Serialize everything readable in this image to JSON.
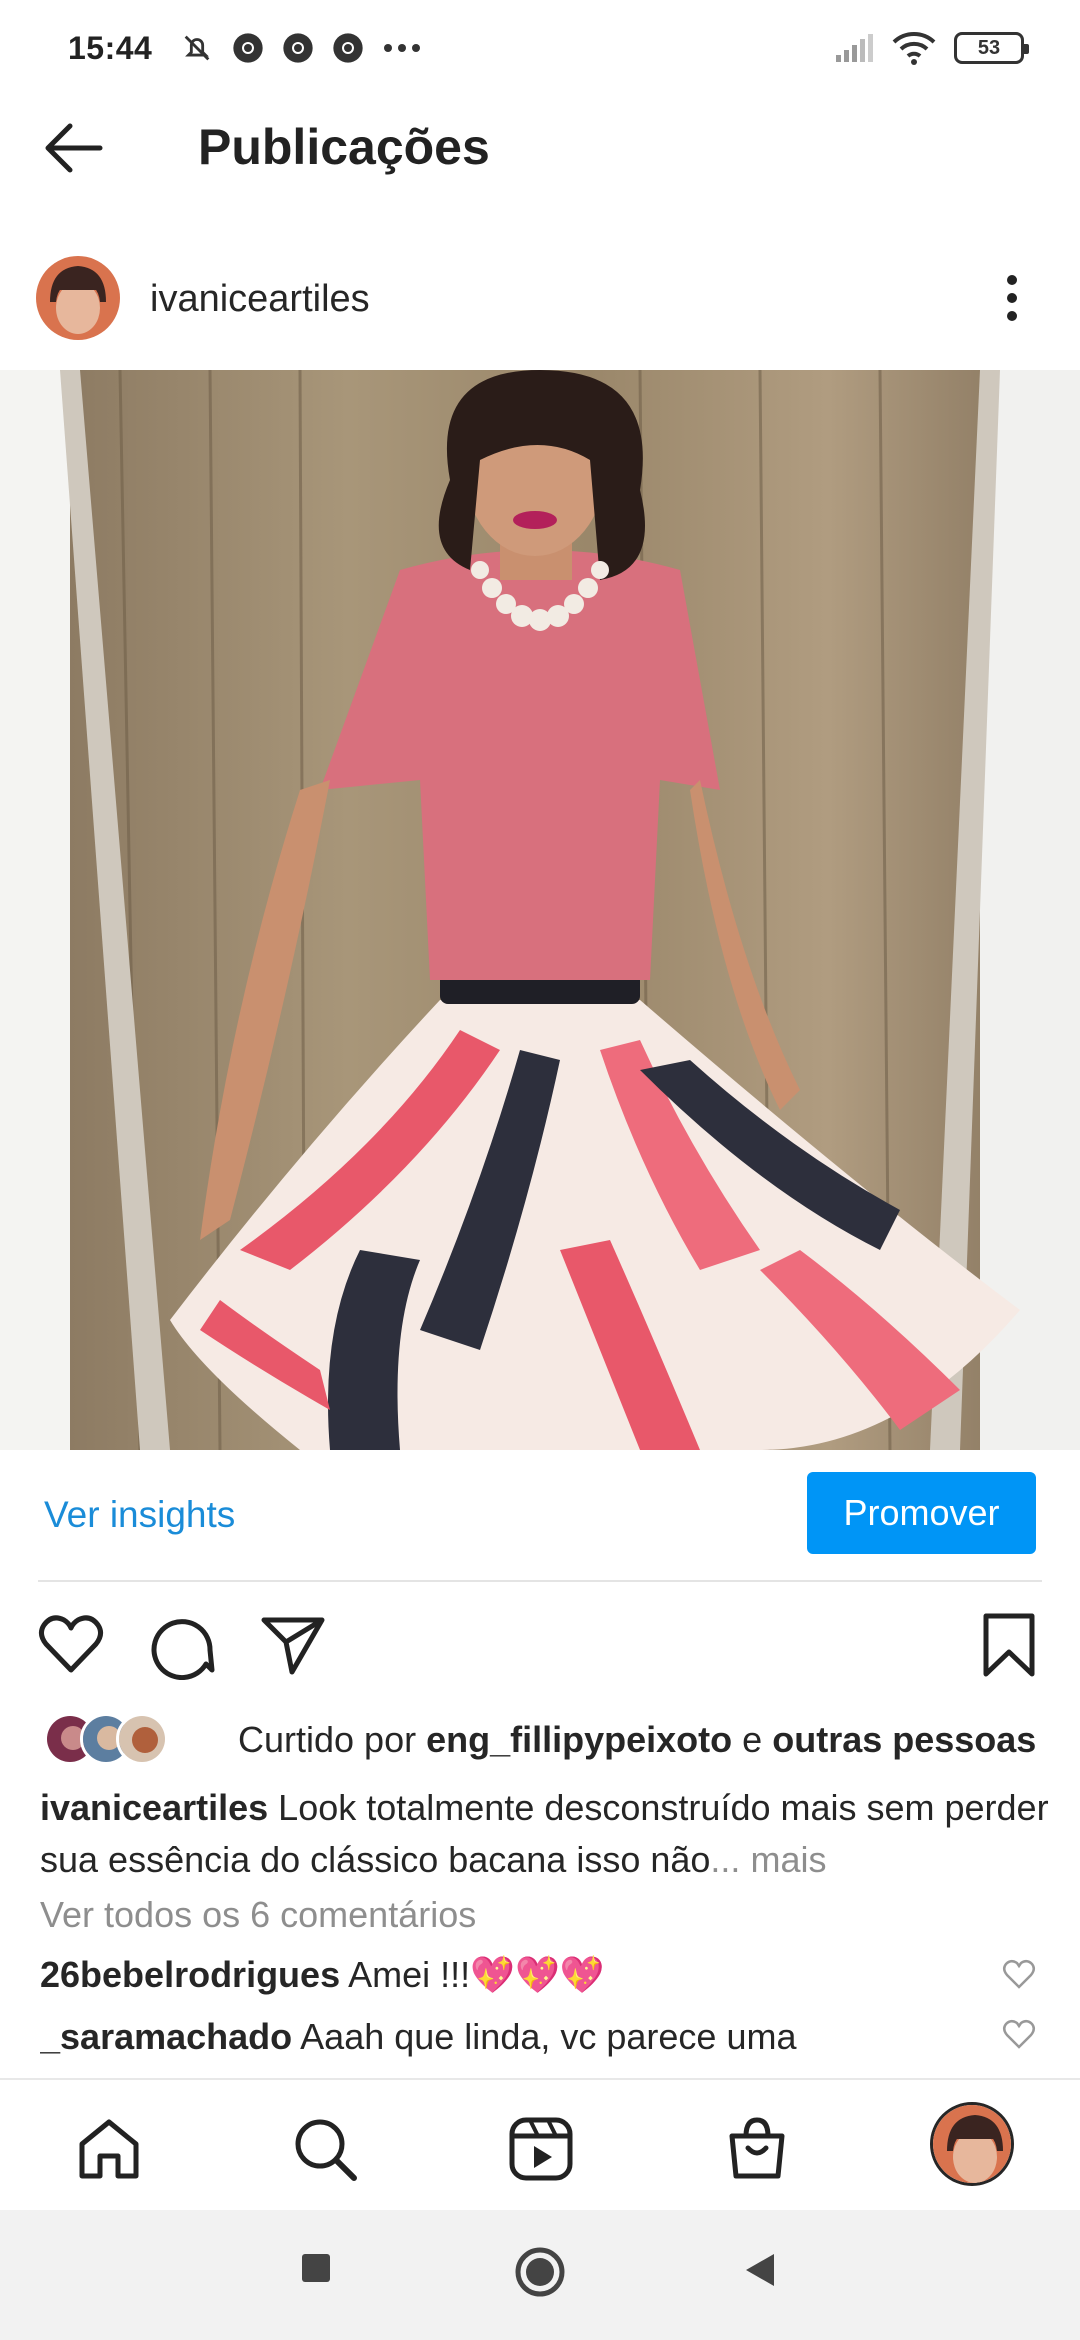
{
  "status_bar": {
    "time": "15:44",
    "battery": "53",
    "icons_left": [
      "mute-bell-icon",
      "chrome-icon",
      "chrome-icon",
      "chrome-icon",
      "more-dots-icon"
    ],
    "icons_right": [
      "signal-icon",
      "wifi-icon",
      "battery-icon"
    ]
  },
  "header": {
    "title": "Publicações",
    "back_icon": "back-arrow-icon"
  },
  "post": {
    "username": "ivaniceartiles",
    "more_icon": "vertical-dots-icon",
    "photo_description_icon": "photo"
  },
  "insights": {
    "ver_insights": "Ver insights",
    "promover": "Promover"
  },
  "actions": [
    "heart-icon",
    "comment-icon",
    "share-icon",
    "bookmark-icon"
  ],
  "likes": {
    "prefix": "Curtido por",
    "user": "eng_fillipypeixoto",
    "connector": "e",
    "others": "outras pessoas"
  },
  "caption": {
    "username": "ivaniceartiles",
    "text": "Look totalmente desconstruído mais sem perder sua essência  do clássico bacana isso não",
    "ellipsis": "...",
    "more": "mais"
  },
  "comments_link": "Ver todos os 6 comentários",
  "comments": [
    {
      "user": "26bebelrodrigues",
      "text": "Amei !!!💖💖💖"
    },
    {
      "user": "_saramachado",
      "text": "Aaah que linda, vc parece uma"
    }
  ],
  "bottom_nav": [
    "home-icon",
    "search-icon",
    "reels-icon",
    "shop-icon",
    "profile-avatar"
  ],
  "system_nav": [
    "recents-square-icon",
    "home-circle-icon",
    "back-triangle-icon"
  ],
  "colors": {
    "accent_blue": "#0095f6",
    "link_blue": "#1a8cd8",
    "muted_grey": "#8e8e8e",
    "text": "#262626"
  }
}
